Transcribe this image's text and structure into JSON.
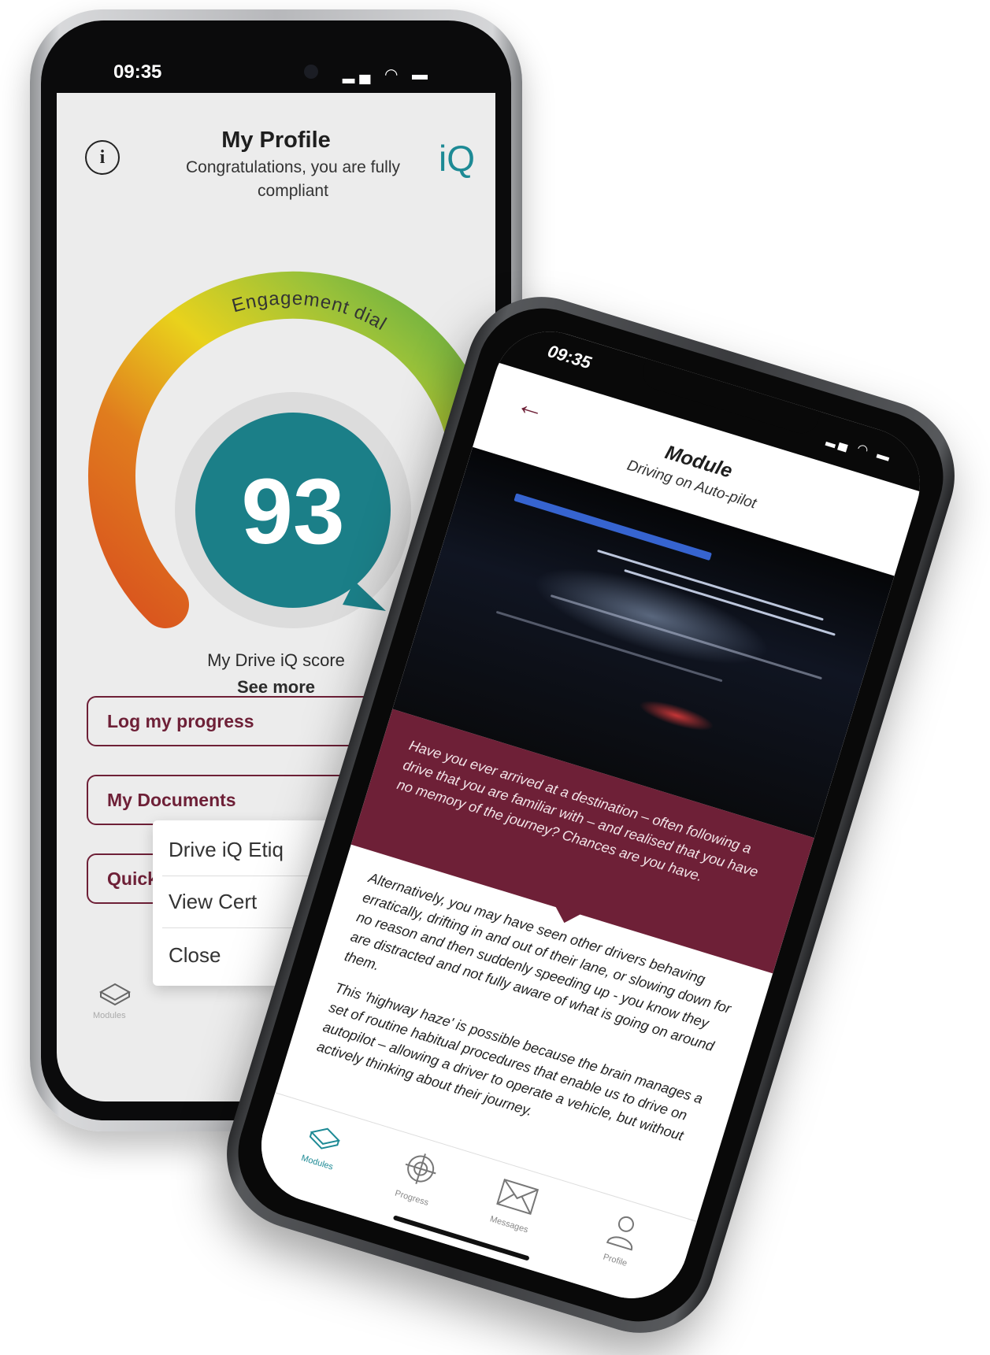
{
  "profile_phone": {
    "status_time": "09:35",
    "title": "My Profile",
    "subtitle": "Congratulations, you are fully compliant",
    "logo": "iQ",
    "dial_label": "Engagement dial",
    "score": "93",
    "score_label": "My Drive iQ score",
    "see_more": "See more",
    "menu": [
      {
        "label": "Log my progress"
      },
      {
        "label": "My Documents"
      },
      {
        "label": "Quick"
      }
    ],
    "popup": [
      {
        "label": "Drive iQ Etiq"
      },
      {
        "label": "View Cert"
      },
      {
        "label": "Close"
      }
    ],
    "tab_label": "Modules",
    "dial_colors": [
      "#d9531e",
      "#e6a21a",
      "#e9d21c",
      "#98c13a",
      "#58a845"
    ],
    "score_color": "#1b7f88"
  },
  "module_phone": {
    "status_time": "09:35",
    "title": "Module",
    "subtitle": "Driving on Auto-pilot",
    "quote": "Have you ever arrived at a destination – often following a drive that you are familiar with – and realised that you have no memory of the journey? Chances are you have.",
    "body": [
      "Alternatively, you may have seen other drivers behaving erratically, drifting in and out of their lane, or slowing down for no reason and then suddenly speeding up - you know they are distracted and not fully aware of what is going on around them.",
      "This 'highway haze' is possible because the brain manages a set of routine habitual procedures that enable us to drive on autopilot – allowing a driver to operate a vehicle, but without actively thinking about their journey."
    ],
    "tabs": [
      {
        "label": "Modules",
        "icon": "book-icon"
      },
      {
        "label": "Progress",
        "icon": "target-icon"
      },
      {
        "label": "Messages",
        "icon": "envelope-icon"
      },
      {
        "label": "Profile",
        "icon": "user-icon"
      }
    ],
    "accent": "#6e2037"
  }
}
